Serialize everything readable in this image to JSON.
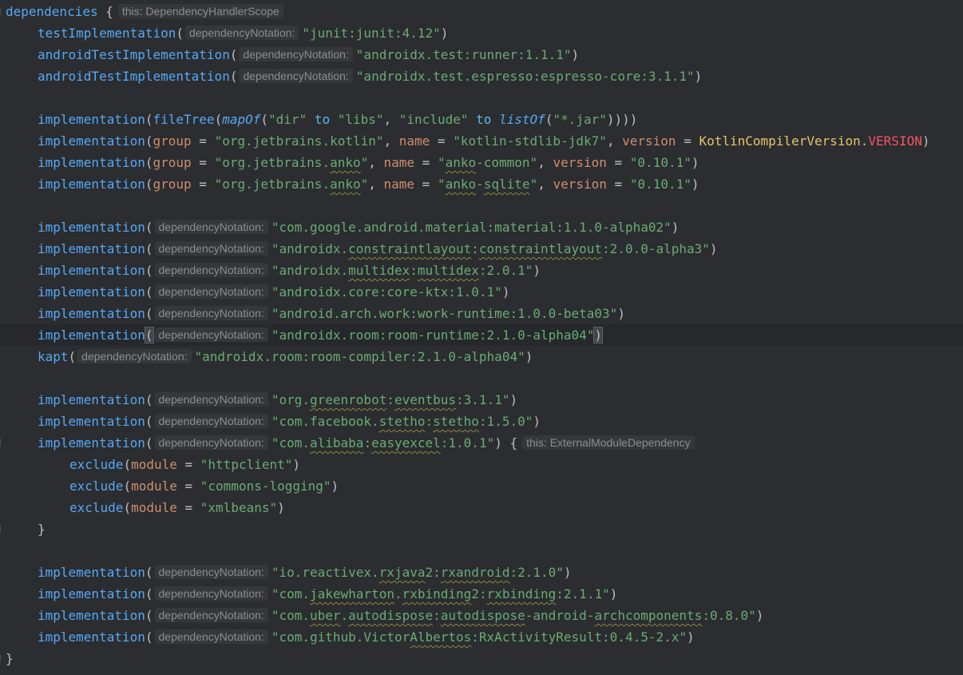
{
  "editor": {
    "hint_dependency_notation": "dependencyNotation:",
    "line1": {
      "kw": "dependencies",
      "brace": " {",
      "hint": "this: DependencyHandlerScope"
    },
    "test_impl": {
      "fn": "testImplementation",
      "open": "(",
      "str": "\"junit:junit:4.12\"",
      "close": ")"
    },
    "android_test_1": {
      "fn": "androidTestImplementation",
      "open": "(",
      "str": "\"androidx.test:runner:1.1.1\"",
      "close": ")"
    },
    "android_test_2": {
      "fn": "androidTestImplementation",
      "open": "(",
      "str": "\"androidx.test.espresso:espresso-core:3.1.1\"",
      "close": ")"
    },
    "filetree": {
      "fn": "implementation",
      "p1": "(",
      "fn2": "fileTree",
      "p2": "(",
      "fn3": "mapOf",
      "p3": "(",
      "s1": "\"dir\"",
      "to1": " to ",
      "s2": "\"libs\"",
      "comma": ", ",
      "s3": "\"include\"",
      "to2": " to ",
      "fn4": "listOf",
      "p4": "(",
      "s4": "\"*.jar\"",
      "close": "))))"
    },
    "kotlin_stdlib": {
      "fn": "implementation",
      "open": "(",
      "group_kw": "group",
      "eq": " = ",
      "group_val": "\"org.jetbrains.kotlin\"",
      "sep1": ", ",
      "name_kw": "name",
      "name_val": "\"kotlin-stdlib-jdk7\"",
      "sep2": ", ",
      "version_kw": "version",
      "version_cls": "KotlinCompilerVersion",
      "dot": ".",
      "version_const": "VERSION",
      "close": ")"
    },
    "anko_common": {
      "fn": "implementation",
      "open": "(",
      "group_kw": "group",
      "eq": " = ",
      "group_pre": "\"org.jetbrains.",
      "group_sq": "anko",
      "group_post": "\"",
      "sep1": ", ",
      "name_kw": "name",
      "name_pre": "\"",
      "name_sq": "anko",
      "name_post": "-common\"",
      "sep2": ", ",
      "version_kw": "version",
      "version_val": "\"0.10.1\"",
      "close": ")"
    },
    "anko_sqlite": {
      "fn": "implementation",
      "open": "(",
      "group_kw": "group",
      "eq": " = ",
      "group_pre": "\"org.jetbrains.",
      "group_sq": "anko",
      "group_post": "\"",
      "sep1": ", ",
      "name_kw": "name",
      "name_pre": "\"",
      "name_sq1": "anko",
      "name_mid": "-",
      "name_sq2": "sqlite",
      "name_post": "\"",
      "sep2": ", ",
      "version_kw": "version",
      "version_val": "\"0.10.1\"",
      "close": ")"
    },
    "material": {
      "fn": "implementation",
      "open": "(",
      "str": "\"com.google.android.material:material:1.1.0-alpha02\"",
      "close": ")"
    },
    "constraint": {
      "fn": "implementation",
      "open": "(",
      "s_pre": "\"androidx.",
      "s_sq1": "constraintlayout",
      "s_mid": ":",
      "s_sq2": "constraintlayout",
      "s_post": ":2.0.0-alpha3\"",
      "close": ")"
    },
    "multidex": {
      "fn": "implementation",
      "open": "(",
      "s_pre": "\"androidx.",
      "s_sq1": "multidex",
      "s_mid": ":",
      "s_sq2": "multidex",
      "s_post": ":2.0.1\"",
      "close": ")"
    },
    "core_ktx": {
      "fn": "implementation",
      "open": "(",
      "str": "\"androidx.core:core-ktx:1.0.1\"",
      "close": ")"
    },
    "work_runtime": {
      "fn": "implementation",
      "open": "(",
      "str": "\"android.arch.work:work-runtime:1.0.0-beta03\"",
      "close": ")"
    },
    "room_runtime": {
      "fn": "implementation",
      "open": "(",
      "str": "\"androidx.room:room-runtime:2.1.0-alpha04\"",
      "close": ")"
    },
    "room_compiler": {
      "fn": "kapt",
      "open": "(",
      "str": "\"androidx.room:room-compiler:2.1.0-alpha04\"",
      "close": ")"
    },
    "eventbus": {
      "fn": "implementation",
      "open": "(",
      "s_pre": "\"org.",
      "s_sq1": "greenrobot",
      "s_mid": ":",
      "s_sq2": "eventbus",
      "s_post": ":3.1.1\"",
      "close": ")"
    },
    "stetho": {
      "fn": "implementation",
      "open": "(",
      "s_pre": "\"com.facebook.",
      "s_sq1": "stetho",
      "s_mid": ":",
      "s_sq2": "stetho",
      "s_post": ":1.5.0\"",
      "close": ")"
    },
    "easyexcel": {
      "fn": "implementation",
      "open": "(",
      "s_pre": "\"com.",
      "s_sq1": "alibaba",
      "s_mid": ":",
      "s_sq2": "easyexcel",
      "s_post": ":1.0.1\"",
      "close": ")",
      "brace": " {",
      "hint": "this: ExternalModuleDependency"
    },
    "exclude1": {
      "fn": "exclude",
      "open": "(",
      "kw": "module",
      "eq": " = ",
      "str": "\"httpclient\"",
      "close": ")"
    },
    "exclude2": {
      "fn": "exclude",
      "open": "(",
      "kw": "module",
      "eq": " = ",
      "str": "\"commons-logging\"",
      "close": ")"
    },
    "exclude3": {
      "fn": "exclude",
      "open": "(",
      "kw": "module",
      "eq": " = ",
      "str": "\"xmlbeans\"",
      "close": ")"
    },
    "inner_close": "}",
    "rxandroid": {
      "fn": "implementation",
      "open": "(",
      "s_pre": "\"io.reactivex.",
      "s_sq1": "rxjava",
      "s_mid": "2:",
      "s_sq2": "rxandroid",
      "s_post": ":2.1.0\"",
      "close": ")"
    },
    "rxbinding": {
      "fn": "implementation",
      "open": "(",
      "s_pre": "\"com.",
      "s_sq1": "jakewharton",
      "s_mid1": ".",
      "s_sq2": "rxbinding",
      "s_mid2": "2:",
      "s_sq3": "rxbinding",
      "s_post": ":2.1.1\"",
      "close": ")"
    },
    "autodispose": {
      "fn": "implementation",
      "open": "(",
      "s_pre": "\"com.",
      "s_sq1": "uber",
      "s_mid1": ".",
      "s_sq2": "autodispose",
      "s_mid2": ":",
      "s_sq3": "autodispose",
      "s_mid3": "-android-",
      "s_sq4": "archcomponents",
      "s_post": ":0.8.0\"",
      "close": ")"
    },
    "rxactivity": {
      "fn": "implementation",
      "open": "(",
      "s_pre": "\"com.github.Victor",
      "s_sq1": "Albertos",
      "s_post": ":RxActivityResult:0.4.5-2.x\"",
      "close": ")"
    },
    "outer_close": "}"
  },
  "colors": {
    "background": "#2b2d30",
    "function": "#56a8f5",
    "string": "#6aab73",
    "named_param": "#cf8e6d",
    "constant": "#f75464",
    "class": "#e8c46a",
    "inlay_hint": "#8a8d93"
  }
}
